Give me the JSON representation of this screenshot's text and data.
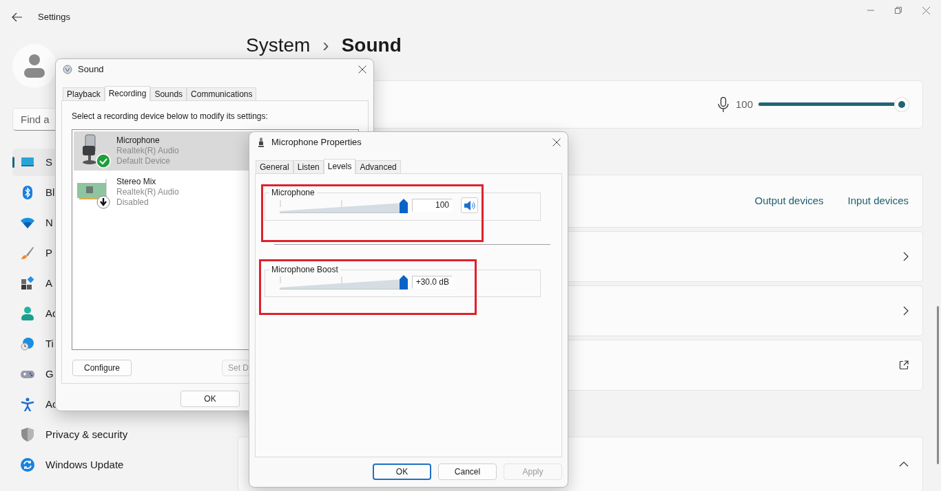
{
  "settings": {
    "title": "Settings",
    "search": {
      "placeholder": "Find a"
    },
    "sidebar": {
      "items": [
        {
          "label": "S",
          "kind": "system",
          "selected": true
        },
        {
          "label": "Bl",
          "kind": "bluetooth",
          "selected": false
        },
        {
          "label": "N",
          "kind": "network",
          "selected": false
        },
        {
          "label": "P",
          "kind": "personalization",
          "selected": false
        },
        {
          "label": "A",
          "kind": "apps",
          "selected": false
        },
        {
          "label": "Ac",
          "kind": "accounts",
          "selected": false
        },
        {
          "label": "Ti",
          "kind": "time",
          "selected": false
        },
        {
          "label": "G",
          "kind": "gaming",
          "selected": false
        },
        {
          "label": "Ac",
          "kind": "accessibility",
          "selected": false
        },
        {
          "label": "Privacy & security",
          "kind": "privacy",
          "selected": false
        },
        {
          "label": "Windows Update",
          "kind": "update",
          "selected": false
        }
      ]
    },
    "breadcrumb": {
      "parent": "System",
      "separator": "›",
      "current": "Sound"
    },
    "sections": [
      [
        {
          "kind": "input-volume",
          "value": "100",
          "level": 1.0
        }
      ],
      [
        {
          "kind": "links",
          "links": [
            "Output devices",
            "Input devices"
          ]
        },
        {
          "kind": "chevron"
        },
        {
          "kind": "chevron"
        },
        {
          "kind": "external-link"
        }
      ],
      [
        {
          "kind": "collapse",
          "expanded": true
        }
      ]
    ]
  },
  "sound_dialog": {
    "title": "Sound",
    "tabs": [
      {
        "label": "Playback",
        "selected": false
      },
      {
        "label": "Recording",
        "selected": true
      },
      {
        "label": "Sounds",
        "selected": false
      },
      {
        "label": "Communications",
        "selected": false
      }
    ],
    "instruction": "Select a recording device below to modify its settings:",
    "devices": [
      {
        "kind": "microphone",
        "name": "Microphone",
        "driver": "Realtek(R) Audio",
        "status": "Default Device",
        "default_device": true,
        "disabled": false,
        "selected": true
      },
      {
        "kind": "sound-card",
        "name": "Stereo Mix",
        "driver": "Realtek(R) Audio",
        "status": "Disabled",
        "default_device": false,
        "disabled": true,
        "selected": false
      }
    ],
    "buttons": [
      {
        "label": "Configure",
        "disabled": false
      },
      {
        "label": "Set D",
        "disabled": true
      }
    ],
    "footer_buttons": [
      {
        "label": "OK",
        "disabled": false
      }
    ]
  },
  "properties_dialog": {
    "title": "Microphone Properties",
    "tabs": [
      {
        "label": "General",
        "selected": false
      },
      {
        "label": "Listen",
        "selected": false
      },
      {
        "label": "Levels",
        "selected": true
      },
      {
        "label": "Advanced",
        "selected": false
      }
    ],
    "groups": [
      {
        "label": "Microphone",
        "level": 1.0,
        "value": "100",
        "mute_button": true,
        "highlighted": true
      },
      {
        "label": "Microphone Boost",
        "level": 1.0,
        "value": "+30.0 dB",
        "mute_button": false,
        "highlighted": true
      }
    ],
    "buttons": [
      {
        "label": "OK",
        "default": true,
        "disabled": false
      },
      {
        "label": "Cancel",
        "default": false,
        "disabled": false
      },
      {
        "label": "Apply",
        "default": false,
        "disabled": true
      }
    ]
  }
}
